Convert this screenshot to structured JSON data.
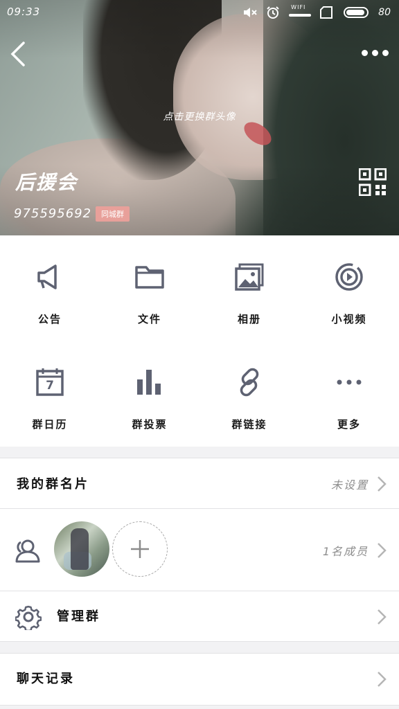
{
  "status_bar": {
    "time": "09:33",
    "wifi_label": "WIFI",
    "battery": "80"
  },
  "header": {
    "change_avatar_hint": "点击更换群头像",
    "group_name": "后援会",
    "group_id": "975595692",
    "group_tag": "同城群"
  },
  "functions": [
    {
      "label": "公告",
      "icon": "megaphone-icon"
    },
    {
      "label": "文件",
      "icon": "folder-icon"
    },
    {
      "label": "相册",
      "icon": "album-icon"
    },
    {
      "label": "小视频",
      "icon": "video-icon"
    },
    {
      "label": "群日历",
      "icon": "calendar-icon"
    },
    {
      "label": "群投票",
      "icon": "bar-chart-icon"
    },
    {
      "label": "群链接",
      "icon": "link-icon"
    },
    {
      "label": "更多",
      "icon": "more-dots-icon"
    }
  ],
  "calendar_day": "7",
  "rows": {
    "group_card": {
      "title": "我的群名片",
      "value": "未设置"
    },
    "members": {
      "value": "1名成员"
    },
    "manage": {
      "title": "管理群"
    },
    "chat_history": {
      "title": "聊天记录"
    }
  },
  "colors": {
    "icon_gray": "#5e6272",
    "tag_pink": "#e8a09a"
  }
}
